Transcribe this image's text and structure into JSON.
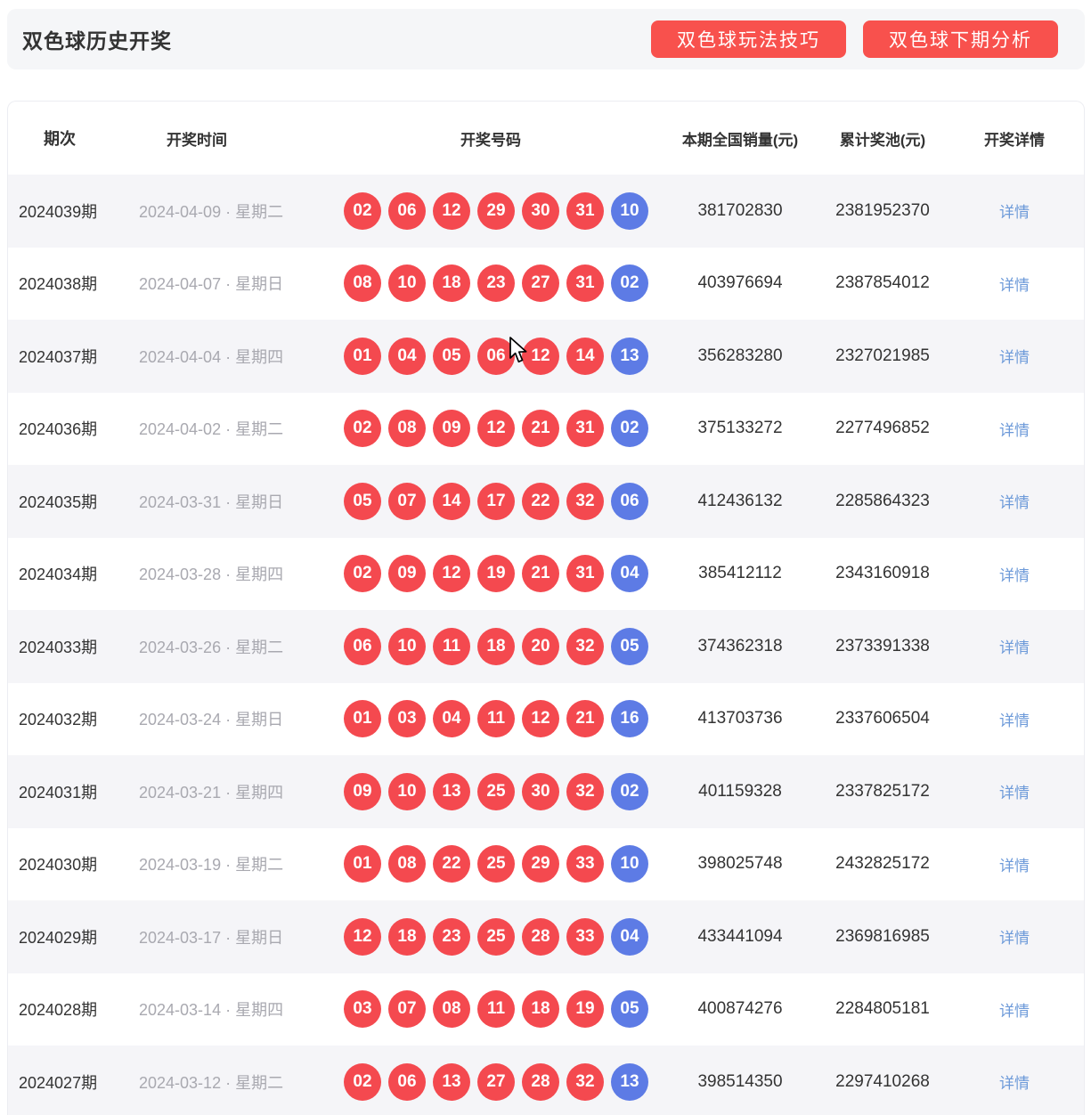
{
  "header": {
    "title": "双色球历史开奖",
    "buttons": [
      {
        "label": "双色球玩法技巧"
      },
      {
        "label": "双色球下期分析"
      }
    ]
  },
  "table": {
    "columns": [
      "期次",
      "开奖时间",
      "开奖号码",
      "本期全国销量(元)",
      "累计奖池(元)",
      "开奖详情"
    ],
    "period_suffix": "期",
    "detail_label": "详情",
    "rows": [
      {
        "period": "2024039",
        "date": "2024-04-09 · 星期二",
        "red": [
          "02",
          "06",
          "12",
          "29",
          "30",
          "31"
        ],
        "blue": "10",
        "sales": "381702830",
        "jackpot": "2381952370"
      },
      {
        "period": "2024038",
        "date": "2024-04-07 · 星期日",
        "red": [
          "08",
          "10",
          "18",
          "23",
          "27",
          "31"
        ],
        "blue": "02",
        "sales": "403976694",
        "jackpot": "2387854012"
      },
      {
        "period": "2024037",
        "date": "2024-04-04 · 星期四",
        "red": [
          "01",
          "04",
          "05",
          "06",
          "12",
          "14"
        ],
        "blue": "13",
        "sales": "356283280",
        "jackpot": "2327021985"
      },
      {
        "period": "2024036",
        "date": "2024-04-02 · 星期二",
        "red": [
          "02",
          "08",
          "09",
          "12",
          "21",
          "31"
        ],
        "blue": "02",
        "sales": "375133272",
        "jackpot": "2277496852"
      },
      {
        "period": "2024035",
        "date": "2024-03-31 · 星期日",
        "red": [
          "05",
          "07",
          "14",
          "17",
          "22",
          "32"
        ],
        "blue": "06",
        "sales": "412436132",
        "jackpot": "2285864323"
      },
      {
        "period": "2024034",
        "date": "2024-03-28 · 星期四",
        "red": [
          "02",
          "09",
          "12",
          "19",
          "21",
          "31"
        ],
        "blue": "04",
        "sales": "385412112",
        "jackpot": "2343160918"
      },
      {
        "period": "2024033",
        "date": "2024-03-26 · 星期二",
        "red": [
          "06",
          "10",
          "11",
          "18",
          "20",
          "32"
        ],
        "blue": "05",
        "sales": "374362318",
        "jackpot": "2373391338"
      },
      {
        "period": "2024032",
        "date": "2024-03-24 · 星期日",
        "red": [
          "01",
          "03",
          "04",
          "11",
          "12",
          "21"
        ],
        "blue": "16",
        "sales": "413703736",
        "jackpot": "2337606504"
      },
      {
        "period": "2024031",
        "date": "2024-03-21 · 星期四",
        "red": [
          "09",
          "10",
          "13",
          "25",
          "30",
          "32"
        ],
        "blue": "02",
        "sales": "401159328",
        "jackpot": "2337825172"
      },
      {
        "period": "2024030",
        "date": "2024-03-19 · 星期二",
        "red": [
          "01",
          "08",
          "22",
          "25",
          "29",
          "33"
        ],
        "blue": "10",
        "sales": "398025748",
        "jackpot": "2432825172"
      },
      {
        "period": "2024029",
        "date": "2024-03-17 · 星期日",
        "red": [
          "12",
          "18",
          "23",
          "25",
          "28",
          "33"
        ],
        "blue": "04",
        "sales": "433441094",
        "jackpot": "2369816985"
      },
      {
        "period": "2024028",
        "date": "2024-03-14 · 星期四",
        "red": [
          "03",
          "07",
          "08",
          "11",
          "18",
          "19"
        ],
        "blue": "05",
        "sales": "400874276",
        "jackpot": "2284805181"
      },
      {
        "period": "2024027",
        "date": "2024-03-12 · 星期二",
        "red": [
          "02",
          "06",
          "13",
          "27",
          "28",
          "32"
        ],
        "blue": "13",
        "sales": "398514350",
        "jackpot": "2297410268"
      }
    ]
  },
  "colors": {
    "button_red": "#f8514d",
    "ball_red": "#f4494f",
    "ball_blue": "#5d7be5",
    "detail_link_blue": "#6d9ad9",
    "odd_row_bg": "#f5f5f8",
    "titlebar_bg": "#f5f6f8"
  }
}
